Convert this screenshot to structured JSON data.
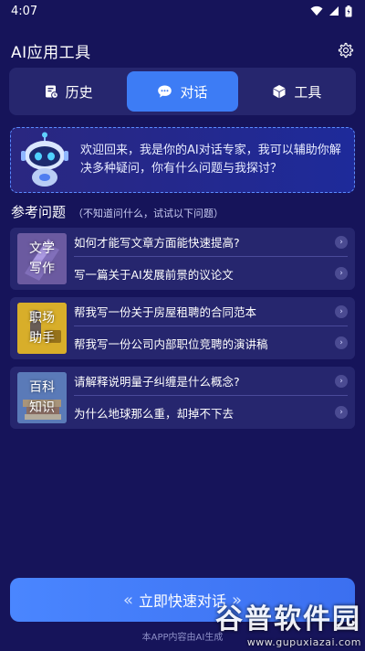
{
  "status_bar": {
    "time": "4:07"
  },
  "header": {
    "title": "AI应用工具",
    "settings_icon": "gear-icon"
  },
  "tabs": [
    {
      "label": "历史",
      "icon": "history-icon",
      "active": false
    },
    {
      "label": "对话",
      "icon": "chat-bubble-icon",
      "active": true
    },
    {
      "label": "工具",
      "icon": "cube-icon",
      "active": false
    }
  ],
  "welcome": {
    "icon": "robot-icon",
    "text": "欢迎回来，我是你的AI对话专家，我可以辅助你解决多种疑问，你有什么问题与我探讨？"
  },
  "reference": {
    "title": "参考问题",
    "subtitle": "（不知道问什么，试试以下问题）"
  },
  "cards": [
    {
      "badge_line1": "文学",
      "badge_line2": "写作",
      "badge_color": "#5a4a8a",
      "questions": [
        "如何才能写文章方面能快速提高?",
        "写一篇关于AI发展前景的议论文"
      ]
    },
    {
      "badge_line1": "职场",
      "badge_line2": "助手",
      "badge_color": "#c9a227",
      "questions": [
        "帮我写一份关于房屋租聘的合同范本",
        "帮我写一份公司内部职位竞聘的演讲稿"
      ]
    },
    {
      "badge_line1": "百科",
      "badge_line2": "知识",
      "badge_color": "#4a6aa0",
      "questions": [
        "请解释说明量子纠缠是什么概念?",
        "为什么地球那么重，却掉不下去"
      ]
    }
  ],
  "cta": {
    "label": "立即快速对话"
  },
  "footer": {
    "note": "本APP内容由AI生成"
  },
  "watermark": {
    "main": "谷普软件园",
    "url": "www.gupuxiazai.com"
  },
  "colors": {
    "background": "#16145a",
    "card": "#26266e",
    "accent": "#3d7cf5"
  }
}
